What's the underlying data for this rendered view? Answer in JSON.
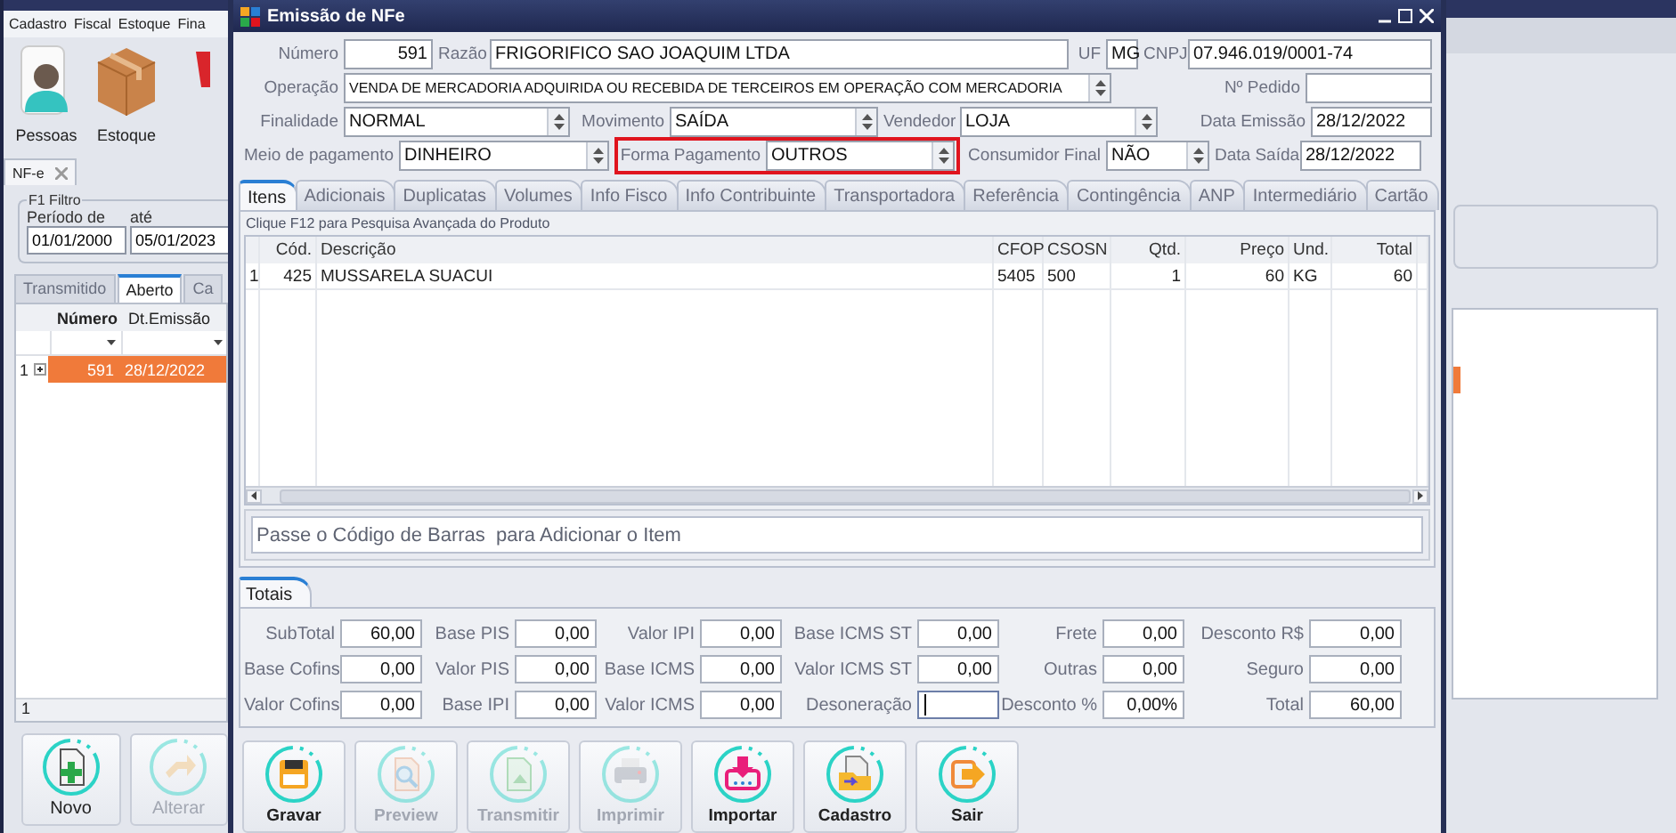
{
  "background_app": {
    "menu": [
      "Cadastro",
      "Fiscal",
      "Estoque",
      "Fina"
    ],
    "toolbar": [
      {
        "label": "Pessoas",
        "kind": "person"
      },
      {
        "label": "Estoque",
        "kind": "box"
      },
      {
        "kind": "partial"
      }
    ],
    "document_tab": "NF-e",
    "filter": {
      "title": "F1 Filtro",
      "from_label": "Período de",
      "to_label": "até",
      "from": "01/01/2000",
      "to": "05/01/2023"
    },
    "tabs": [
      {
        "label": "Transmitido",
        "selected": false
      },
      {
        "label": "Aberto",
        "selected": true
      },
      {
        "label": "Ca",
        "selected": false
      }
    ],
    "grid": {
      "columns": [
        "Número",
        "Dt.Emissão"
      ],
      "rows": [
        {
          "index": "1",
          "numero": "591",
          "data": "28/12/2022",
          "selected": true
        }
      ],
      "footer": "1"
    },
    "buttons": [
      {
        "label": "Novo",
        "kind": "new",
        "disabled": false
      },
      {
        "label": "Alterar",
        "kind": "edit",
        "disabled": true
      }
    ]
  },
  "window": {
    "title": "Emissão de NFe"
  },
  "form": {
    "rows": [
      {
        "fields": [
          {
            "label": "Número",
            "value": "591",
            "kind": "number",
            "highlighted": false
          },
          {
            "label": "Razão",
            "value": "FRIGORIFICO SAO JOAQUIM LTDA",
            "kind": "text",
            "highlighted": false
          },
          {
            "label": "UF",
            "value": "MG",
            "kind": "text",
            "highlighted": false
          },
          {
            "label": "CNPJ",
            "value": "07.946.019/0001-74",
            "kind": "text",
            "highlighted": false
          }
        ]
      },
      {
        "fields": [
          {
            "label": "Operação",
            "value": "VENDA DE MERCADORIA ADQUIRIDA OU RECEBIDA DE TERCEIROS EM OPERAÇÃO COM MERCADORIA",
            "kind": "select",
            "highlighted": false
          },
          {
            "label": "Nº Pedido",
            "kind": "text",
            "highlighted": false
          }
        ]
      },
      {
        "fields": [
          {
            "label": "Finalidade",
            "value": "NORMAL",
            "kind": "select",
            "highlighted": false
          },
          {
            "label": "Movimento",
            "value": "SAÍDA",
            "kind": "select",
            "highlighted": false
          },
          {
            "label": "Vendedor",
            "value": "LOJA",
            "kind": "select",
            "highlighted": false
          },
          {
            "label": "Data Emissão",
            "value": "28/12/2022",
            "kind": "text",
            "highlighted": false
          }
        ]
      },
      {
        "fields": [
          {
            "label": "Meio de pagamento",
            "value": "DINHEIRO",
            "kind": "select",
            "highlighted": false
          },
          {
            "label": "Forma Pagamento",
            "value": "OUTROS",
            "kind": "select",
            "highlighted": true
          },
          {
            "label": "Consumidor Final",
            "value": "NÃO",
            "kind": "select",
            "highlighted": false
          },
          {
            "label": "Data Saída",
            "value": "28/12/2022",
            "kind": "text",
            "highlighted": false
          }
        ]
      }
    ]
  },
  "tabs": [
    {
      "label": "Itens",
      "selected": true
    },
    {
      "label": "Adicionais",
      "selected": false
    },
    {
      "label": "Duplicatas",
      "selected": false
    },
    {
      "label": "Volumes",
      "selected": false
    },
    {
      "label": "Info Fisco",
      "selected": false
    },
    {
      "label": "Info Contribuinte",
      "selected": false
    },
    {
      "label": "Transportadora",
      "selected": false
    },
    {
      "label": "Referência",
      "selected": false
    },
    {
      "label": "Contingência",
      "selected": false
    },
    {
      "label": "ANP",
      "selected": false
    },
    {
      "label": "Intermediário",
      "selected": false
    },
    {
      "label": "Cartão",
      "selected": false
    }
  ],
  "hint": "Clique F12 para Pesquisa Avançada do Produto",
  "items_table": {
    "columns": [
      "Cód.",
      "Descrição",
      "CFOP",
      "CSOSN",
      "Qtd.",
      "Preço",
      "Und.",
      "Total"
    ],
    "rows": [
      {
        "index": "1",
        "cells": [
          "425",
          "MUSSARELA SUACUI",
          "5405",
          "500",
          "1",
          "60",
          "KG",
          "60"
        ]
      }
    ]
  },
  "barcode": {
    "placeholder": "Passe o Código de Barras  para Adicionar o Item"
  },
  "totals": {
    "tab": "Totais",
    "fields": [
      {
        "label": "SubTotal",
        "value": "60,00",
        "focused": false
      },
      {
        "label": "Base PIS",
        "value": "0,00",
        "focused": false
      },
      {
        "label": "Valor IPI",
        "value": "0,00",
        "focused": false
      },
      {
        "label": "Base ICMS ST",
        "value": "0,00",
        "focused": false
      },
      {
        "label": "Frete",
        "value": "0,00",
        "focused": false
      },
      {
        "label": "Desconto R$",
        "value": "0,00",
        "focused": false
      },
      {
        "label": "Base Cofins",
        "value": "0,00",
        "focused": false
      },
      {
        "label": "Valor PIS",
        "value": "0,00",
        "focused": false
      },
      {
        "label": "Base ICMS",
        "value": "0,00",
        "focused": false
      },
      {
        "label": "Valor ICMS ST",
        "value": "0,00",
        "focused": false
      },
      {
        "label": "Outras",
        "value": "0,00",
        "focused": false
      },
      {
        "label": "Seguro",
        "value": "0,00",
        "focused": false
      },
      {
        "label": "Valor Cofins",
        "value": "0,00",
        "focused": false
      },
      {
        "label": "Base IPI",
        "value": "0,00",
        "focused": false
      },
      {
        "label": "Valor ICMS",
        "value": "0,00",
        "focused": false
      },
      {
        "label": "Desoneração",
        "focused": true
      },
      {
        "label": "Desconto %",
        "value": "0,00%",
        "focused": false
      },
      {
        "label": "Total",
        "value": "60,00",
        "focused": false
      }
    ]
  },
  "actions": [
    {
      "label": "Gravar",
      "kind": "save",
      "disabled": false
    },
    {
      "label": "Preview",
      "kind": "preview",
      "disabled": true
    },
    {
      "label": "Transmitir",
      "kind": "transmit",
      "disabled": true
    },
    {
      "label": "Imprimir",
      "kind": "print",
      "disabled": true
    },
    {
      "label": "Importar",
      "kind": "import",
      "disabled": false
    },
    {
      "label": "Cadastro",
      "kind": "register",
      "disabled": false
    },
    {
      "label": "Sair",
      "kind": "exit",
      "disabled": false
    }
  ]
}
